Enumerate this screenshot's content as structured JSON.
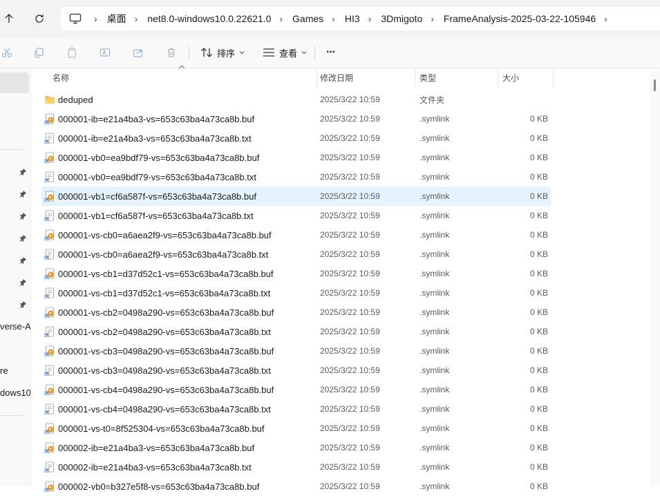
{
  "breadcrumb": {
    "items": [
      "桌面",
      "net8.0-windows10.0.22621.0",
      "Games",
      "HI3",
      "3Dmigoto",
      "FrameAnalysis-2025-03-22-105946"
    ]
  },
  "toolbar": {
    "sort_label": "排序",
    "view_label": "查看",
    "more_label": "···"
  },
  "sidebar": {
    "partial_labels": [
      "verse-A",
      "re",
      "dows10"
    ]
  },
  "columns": {
    "name": "名称",
    "date": "修改日期",
    "type": "类型",
    "size": "大小"
  },
  "files": [
    {
      "name": "deduped",
      "date": "2025/3/22 10:59",
      "type": "文件夹",
      "size": "",
      "icon": "folder-icon"
    },
    {
      "name": "000001-ib=e21a4ba3-vs=653c63ba4a73ca8b.buf",
      "date": "2025/3/22 10:59",
      "type": ".symlink",
      "size": "0 KB",
      "icon": "buf-shortcut-icon"
    },
    {
      "name": "000001-ib=e21a4ba3-vs=653c63ba4a73ca8b.txt",
      "date": "2025/3/22 10:59",
      "type": ".symlink",
      "size": "0 KB",
      "icon": "txt-shortcut-icon"
    },
    {
      "name": "000001-vb0=ea9bdf79-vs=653c63ba4a73ca8b.buf",
      "date": "2025/3/22 10:59",
      "type": ".symlink",
      "size": "0 KB",
      "icon": "buf-shortcut-icon"
    },
    {
      "name": "000001-vb0=ea9bdf79-vs=653c63ba4a73ca8b.txt",
      "date": "2025/3/22 10:59",
      "type": ".symlink",
      "size": "0 KB",
      "icon": "txt-shortcut-icon"
    },
    {
      "name": "000001-vb1=cf6a587f-vs=653c63ba4a73ca8b.buf",
      "date": "2025/3/22 10:59",
      "type": ".symlink",
      "size": "0 KB",
      "icon": "buf-shortcut-icon",
      "hover": true
    },
    {
      "name": "000001-vb1=cf6a587f-vs=653c63ba4a73ca8b.txt",
      "date": "2025/3/22 10:59",
      "type": ".symlink",
      "size": "0 KB",
      "icon": "txt-shortcut-icon"
    },
    {
      "name": "000001-vs-cb0=a6aea2f9-vs=653c63ba4a73ca8b.buf",
      "date": "2025/3/22 10:59",
      "type": ".symlink",
      "size": "0 KB",
      "icon": "buf-shortcut-icon"
    },
    {
      "name": "000001-vs-cb0=a6aea2f9-vs=653c63ba4a73ca8b.txt",
      "date": "2025/3/22 10:59",
      "type": ".symlink",
      "size": "0 KB",
      "icon": "txt-shortcut-icon"
    },
    {
      "name": "000001-vs-cb1=d37d52c1-vs=653c63ba4a73ca8b.buf",
      "date": "2025/3/22 10:59",
      "type": ".symlink",
      "size": "0 KB",
      "icon": "buf-shortcut-icon"
    },
    {
      "name": "000001-vs-cb1=d37d52c1-vs=653c63ba4a73ca8b.txt",
      "date": "2025/3/22 10:59",
      "type": ".symlink",
      "size": "0 KB",
      "icon": "txt-shortcut-icon"
    },
    {
      "name": "000001-vs-cb2=0498a290-vs=653c63ba4a73ca8b.buf",
      "date": "2025/3/22 10:59",
      "type": ".symlink",
      "size": "0 KB",
      "icon": "buf-shortcut-icon"
    },
    {
      "name": "000001-vs-cb2=0498a290-vs=653c63ba4a73ca8b.txt",
      "date": "2025/3/22 10:59",
      "type": ".symlink",
      "size": "0 KB",
      "icon": "txt-shortcut-icon"
    },
    {
      "name": "000001-vs-cb3=0498a290-vs=653c63ba4a73ca8b.buf",
      "date": "2025/3/22 10:59",
      "type": ".symlink",
      "size": "0 KB",
      "icon": "buf-shortcut-icon"
    },
    {
      "name": "000001-vs-cb3=0498a290-vs=653c63ba4a73ca8b.txt",
      "date": "2025/3/22 10:59",
      "type": ".symlink",
      "size": "0 KB",
      "icon": "txt-shortcut-icon"
    },
    {
      "name": "000001-vs-cb4=0498a290-vs=653c63ba4a73ca8b.buf",
      "date": "2025/3/22 10:59",
      "type": ".symlink",
      "size": "0 KB",
      "icon": "buf-shortcut-icon"
    },
    {
      "name": "000001-vs-cb4=0498a290-vs=653c63ba4a73ca8b.txt",
      "date": "2025/3/22 10:59",
      "type": ".symlink",
      "size": "0 KB",
      "icon": "txt-shortcut-icon"
    },
    {
      "name": "000001-vs-t0=8f525304-vs=653c63ba4a73ca8b.buf",
      "date": "2025/3/22 10:59",
      "type": ".symlink",
      "size": "0 KB",
      "icon": "buf-shortcut-icon"
    },
    {
      "name": "000002-ib=e21a4ba3-vs=653c63ba4a73ca8b.buf",
      "date": "2025/3/22 10:59",
      "type": ".symlink",
      "size": "0 KB",
      "icon": "buf-shortcut-icon"
    },
    {
      "name": "000002-ib=e21a4ba3-vs=653c63ba4a73ca8b.txt",
      "date": "2025/3/22 10:59",
      "type": ".symlink",
      "size": "0 KB",
      "icon": "txt-shortcut-icon"
    },
    {
      "name": "000002-vb0=b327e5f8-vs=653c63ba4a73ca8b.buf",
      "date": "2025/3/22 10:59",
      "type": ".symlink",
      "size": "0 KB",
      "icon": "buf-shortcut-icon"
    }
  ],
  "colors": {
    "hover_row": "#e5f3ff",
    "folder": "#f5c244",
    "buf_icon": "#f29b1d"
  }
}
